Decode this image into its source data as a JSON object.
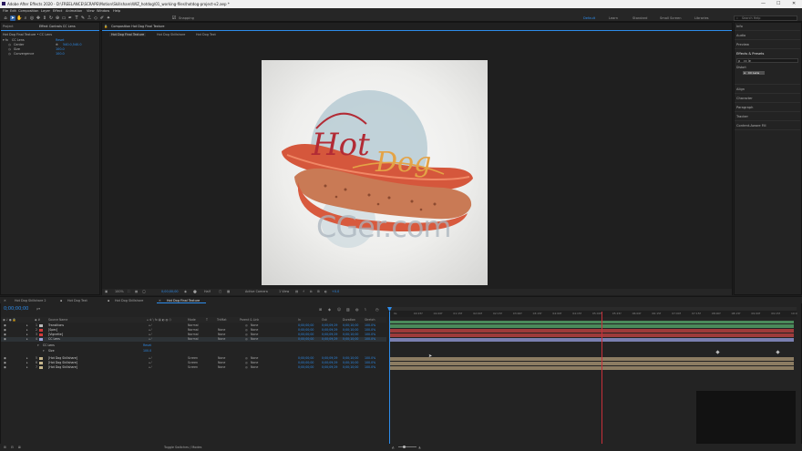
{
  "window": {
    "title": "Adobe After Effects 2020 - D:\\FREELANCE\\SCRAPE\\Motion\\Skillshare\\WIZ_hotdog\\01_working-files\\hotdog-project-v2.aep *",
    "minimize": "—",
    "maximize": "☐",
    "close": "✕"
  },
  "menu": [
    "File",
    "Edit",
    "Composition",
    "Layer",
    "Effect",
    "Animation",
    "View",
    "Window",
    "Help"
  ],
  "toolbar": {
    "snapping_label": "Snapping",
    "workspaces": [
      "Default",
      "Learn",
      "Standard",
      "Small Screen",
      "Libraries"
    ],
    "active_workspace": "Default",
    "search_placeholder": "Search Help"
  },
  "project_panel": {
    "tab_project": "Project",
    "tab_effect_controls": "Effect Controls CC Lens",
    "header": "Hot Dog Final Texture • CC Lens",
    "effect_name": "CC Lens",
    "reset_label": "Reset",
    "properties": [
      {
        "name": "Center",
        "value": "540.0,540.0"
      },
      {
        "name": "Size",
        "value": "100.0"
      },
      {
        "name": "Convergence",
        "value": "100.0"
      }
    ]
  },
  "composition_panel": {
    "tab_label": "Composition Hot Dog Final Texture",
    "breadcrumbs": [
      "Hot Dog Final Texture",
      "Hot Dog Skillshare",
      "Hot Dog Text"
    ],
    "artwork_title_1": "Hot",
    "artwork_title_2": "Dog",
    "watermark": "CGer.com",
    "footer": {
      "zoom": "100%",
      "timecode": "0;00;00;00",
      "resolution": "Half",
      "camera": "Active Camera",
      "views": "1 View",
      "exposure": "+0.0"
    }
  },
  "right_panel": {
    "items": [
      "Info",
      "Audio",
      "Preview",
      "Effects & Presets",
      "Align",
      "Character",
      "Paragraph",
      "Tracker",
      "Content-Aware Fill"
    ],
    "effects_search": "cc le",
    "effects_category": "Distort",
    "effects_result": "CC Lens"
  },
  "timeline": {
    "tabs": [
      "Hot Dog Skillshare 2",
      "Hot Dog Text",
      "Hot Dog Skillshare",
      "Hot Dog Final Texture"
    ],
    "active_tab": "Hot Dog Final Texture",
    "timecode": "0;00;00;00",
    "search_placeholder": "ρ▾",
    "headers": {
      "source_name": "Source Name",
      "mode": "Mode",
      "trkmat": "TrkMat",
      "parent": "Parent & Link",
      "in": "In",
      "out": "Out",
      "duration": "Duration",
      "stretch": "Stretch"
    },
    "layers": [
      {
        "num": "1",
        "name": "Transitions",
        "color": "#b8b8b8",
        "mode": "Normal",
        "trkmat": "",
        "parent": "None",
        "in": "0;00;00;00",
        "out": "0;00;09;29",
        "duration": "0;00;10;00",
        "stretch": "100.0%"
      },
      {
        "num": "2",
        "name": "[Spec]",
        "color": "#d03a3a",
        "mode": "Normal",
        "trkmat": "None",
        "parent": "None",
        "in": "0;00;00;00",
        "out": "0;00;09;29",
        "duration": "0;00;10;00",
        "stretch": "100.0%"
      },
      {
        "num": "3",
        "name": "[Vignette]",
        "color": "#d03a3a",
        "mode": "Normal",
        "trkmat": "None",
        "parent": "None",
        "in": "0;00;00;00",
        "out": "0;00;09;29",
        "duration": "0;00;10;00",
        "stretch": "100.0%"
      },
      {
        "num": "4",
        "name": "CC Lens",
        "color": "#9aa0d6",
        "mode": "Normal",
        "trkmat": "None",
        "parent": "None",
        "in": "0;00;00;00",
        "out": "0;00;09;29",
        "duration": "0;00;10;00",
        "stretch": "100.0%"
      },
      {
        "num": "5",
        "name": "[Hot Dog Skillshare]",
        "color": "#c4b48a",
        "mode": "Screen",
        "trkmat": "None",
        "parent": "None",
        "in": "0;00;00;00",
        "out": "0;00;09;29",
        "duration": "0;00;10;00",
        "stretch": "100.0%"
      },
      {
        "num": "6",
        "name": "[Hot Dog Skillshare]",
        "color": "#c4b48a",
        "mode": "Screen",
        "trkmat": "None",
        "parent": "None",
        "in": "0;00;00;00",
        "out": "0;00;09;29",
        "duration": "0;00;10;00",
        "stretch": "100.0%"
      },
      {
        "num": "7",
        "name": "[Hot Dog Skillshare]",
        "color": "#c4b48a",
        "mode": "Screen",
        "trkmat": "None",
        "parent": "None",
        "in": "0;00;00;00",
        "out": "0;00;09;29",
        "duration": "0;00;10;00",
        "stretch": "100.0%"
      }
    ],
    "sub_rows": [
      {
        "label": "CC Lens",
        "value": "Reset"
      },
      {
        "label": "Size",
        "value": "100.0"
      }
    ],
    "ruler_ticks": [
      "0s",
      "00:15f",
      "01:00f",
      "01:15f",
      "02:00f",
      "02:15f",
      "03:00f",
      "03:15f",
      "04:00f",
      "04:15f",
      "05:00f",
      "05:15f",
      "06:00f",
      "06:15f",
      "07:00f",
      "07:15f",
      "08:00f",
      "08:15f",
      "09:00f",
      "09:15f",
      "10:0"
    ],
    "footer": "Toggle Switches / Modes"
  },
  "colors": {
    "accent": "#2d8ceb",
    "playhead": "#c8303a",
    "bar_green": "#4a8a5a",
    "bar_red": "#9e3b3b",
    "bar_blue": "#7a7fb0",
    "bar_tan": "#8c7c62"
  }
}
